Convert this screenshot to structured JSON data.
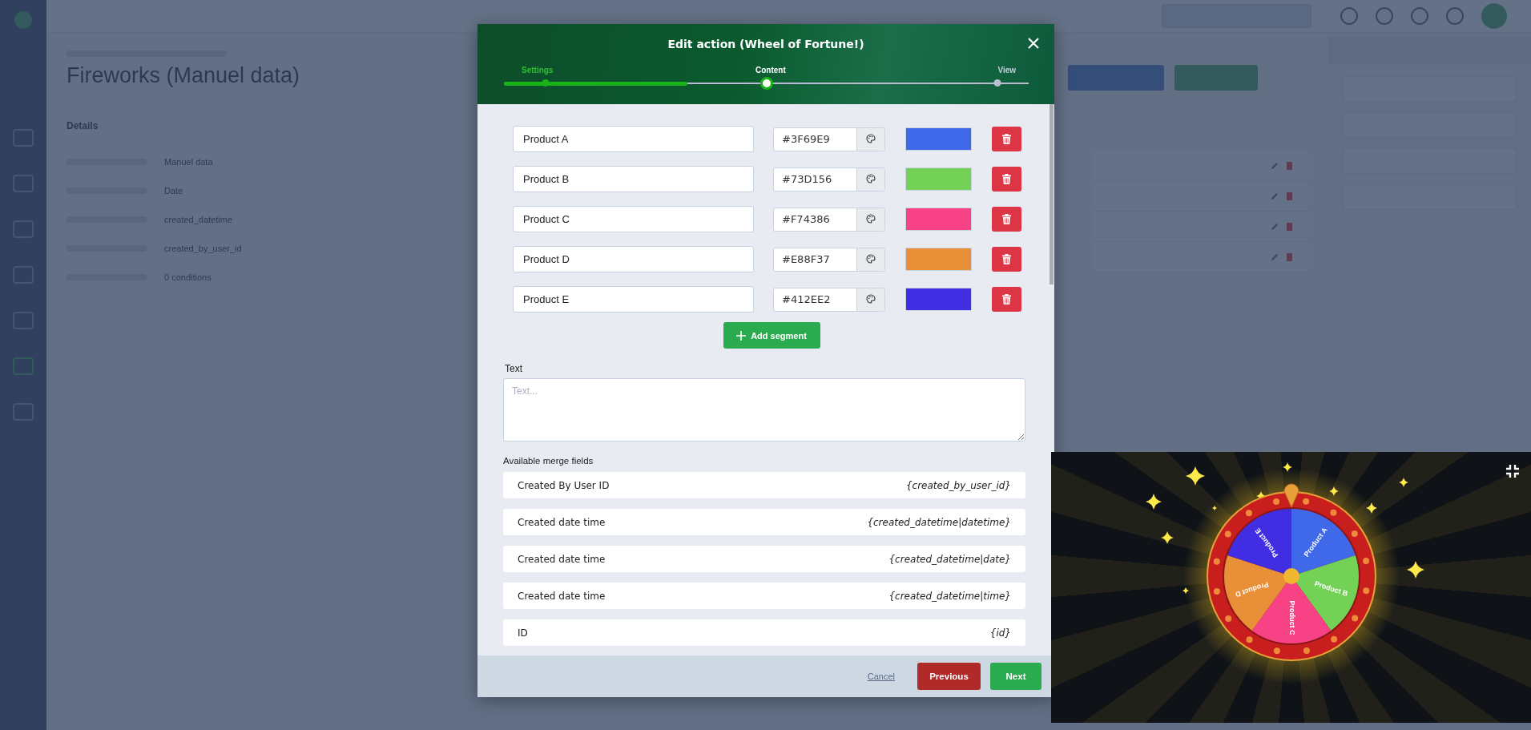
{
  "page": {
    "title": "Fireworks (Manuel data)",
    "section": "Details",
    "details": [
      "Manuel data",
      "Date",
      "created_datetime",
      "created_by_user_id",
      "0 conditions"
    ]
  },
  "modal": {
    "title": "Edit action (Wheel of Fortune!)",
    "steps": [
      {
        "label": "Settings",
        "done": true,
        "selected": false
      },
      {
        "label": "Content",
        "done": false,
        "selected": true
      },
      {
        "label": "View",
        "done": false,
        "selected": false
      }
    ],
    "progress": {
      "level": 0.35
    },
    "segments": [
      {
        "name": "Product A",
        "hex": "#3F69E9",
        "color": "#3f69e9"
      },
      {
        "name": "Product B",
        "hex": "#73D156",
        "color": "#73d156"
      },
      {
        "name": "Product C",
        "hex": "#F74386",
        "color": "#f74386"
      },
      {
        "name": "Product D",
        "hex": "#E88F37",
        "color": "#e88f37"
      },
      {
        "name": "Product E",
        "hex": "#412EE2",
        "color": "#412ee2"
      }
    ],
    "add_segment": "Add segment",
    "text_label": "Text",
    "text_placeholder": "Text...",
    "merge_label": "Available merge fields",
    "merge_fields": [
      {
        "label": "Created By User ID",
        "token": "{created_by_user_id}"
      },
      {
        "label": "Created date time",
        "token": "{created_datetime|datetime}"
      },
      {
        "label": "Created date time",
        "token": "{created_datetime|date}"
      },
      {
        "label": "Created date time",
        "token": "{created_datetime|time}"
      },
      {
        "label": "ID",
        "token": "{id}"
      }
    ],
    "buttons": {
      "cancel": "Cancel",
      "previous": "Previous",
      "next": "Next"
    }
  },
  "preview": {
    "labels": [
      "Product A",
      "Product B",
      "Product C",
      "Product D",
      "Product E"
    ]
  }
}
